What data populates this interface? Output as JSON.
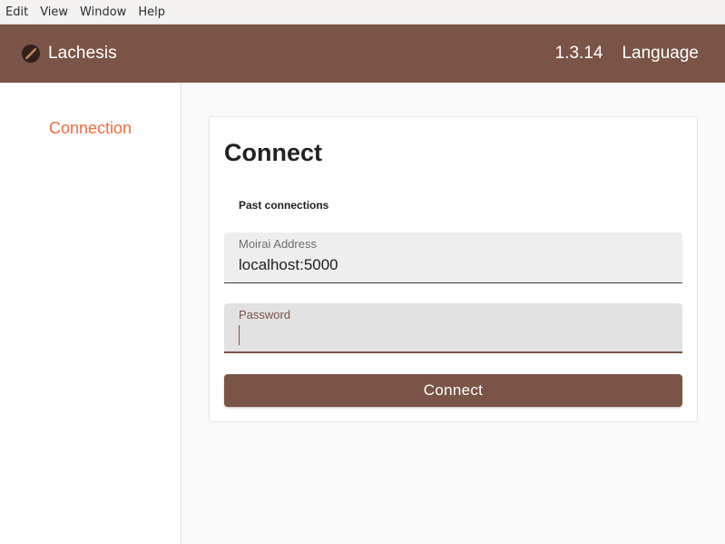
{
  "menubar": {
    "items": [
      "Edit",
      "View",
      "Window",
      "Help"
    ]
  },
  "header": {
    "title": "Lachesis",
    "logo_icon": "lachesis-logo-icon",
    "version": "1.3.14",
    "language_label": "Language"
  },
  "sidebar": {
    "items": [
      {
        "label": "Connection",
        "active": true
      }
    ]
  },
  "card": {
    "title": "Connect",
    "past_connections_label": "Past connections",
    "address": {
      "label": "Moirai Address",
      "value": "localhost:5000"
    },
    "password": {
      "label": "Password",
      "value": ""
    },
    "connect_label": "Connect"
  },
  "colors": {
    "brand": "#7a5446",
    "accent": "#f26b3a",
    "background": "#fafafa"
  }
}
